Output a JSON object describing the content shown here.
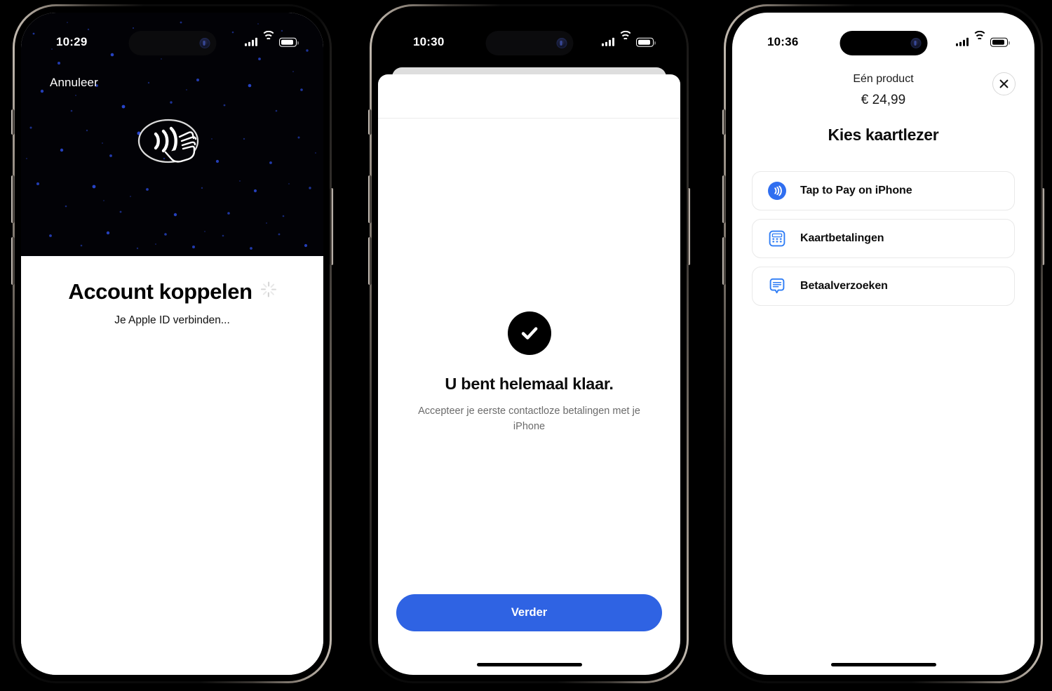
{
  "theme": {
    "accent_blue": "#2f63e3",
    "icon_blue": "#2f7df5",
    "nfc_bg": "#020206",
    "particle_blue": "#1f3bbf",
    "sheet_white": "#ffffff",
    "back_card_grey": "#dedede"
  },
  "phones": [
    {
      "id": "phone-account-linking",
      "status_bar": {
        "time": "10:29",
        "signal_icon": "cellular-bars-icon",
        "wifi_icon": "wifi-icon",
        "battery_icon": "battery-icon"
      },
      "top": {
        "cancel_label": "Annuleer",
        "hero_icon": "contactless-nfc-icon"
      },
      "sheet": {
        "title": "Account koppelen",
        "spinner_icon": "loading-spinner-icon",
        "subtitle": "Je Apple ID verbinden..."
      }
    },
    {
      "id": "phone-setup-complete",
      "status_bar": {
        "time": "10:30",
        "signal_icon": "cellular-bars-icon",
        "wifi_icon": "wifi-icon",
        "battery_icon": "battery-icon"
      },
      "sheet": {
        "success_icon": "checkmark-circle-icon",
        "title": "U bent helemaal klaar.",
        "body": "Accepteer je eerste contactloze betalingen met je iPhone",
        "cta_label": "Verder"
      }
    },
    {
      "id": "phone-choose-card-reader",
      "status_bar": {
        "time": "10:36",
        "signal_icon": "cellular-bars-icon",
        "wifi_icon": "wifi-icon",
        "battery_icon": "battery-icon"
      },
      "header": {
        "product_line": "Eén product",
        "amount": "€ 24,99",
        "close_icon": "close-x-icon"
      },
      "title": "Kies kaartlezer",
      "options": [
        {
          "label": "Tap to Pay on iPhone",
          "icon": "contactless-pay-icon"
        },
        {
          "label": "Kaartbetalingen",
          "icon": "card-terminal-icon"
        },
        {
          "label": "Betaalverzoeken",
          "icon": "payment-request-bubble-icon"
        }
      ]
    }
  ]
}
